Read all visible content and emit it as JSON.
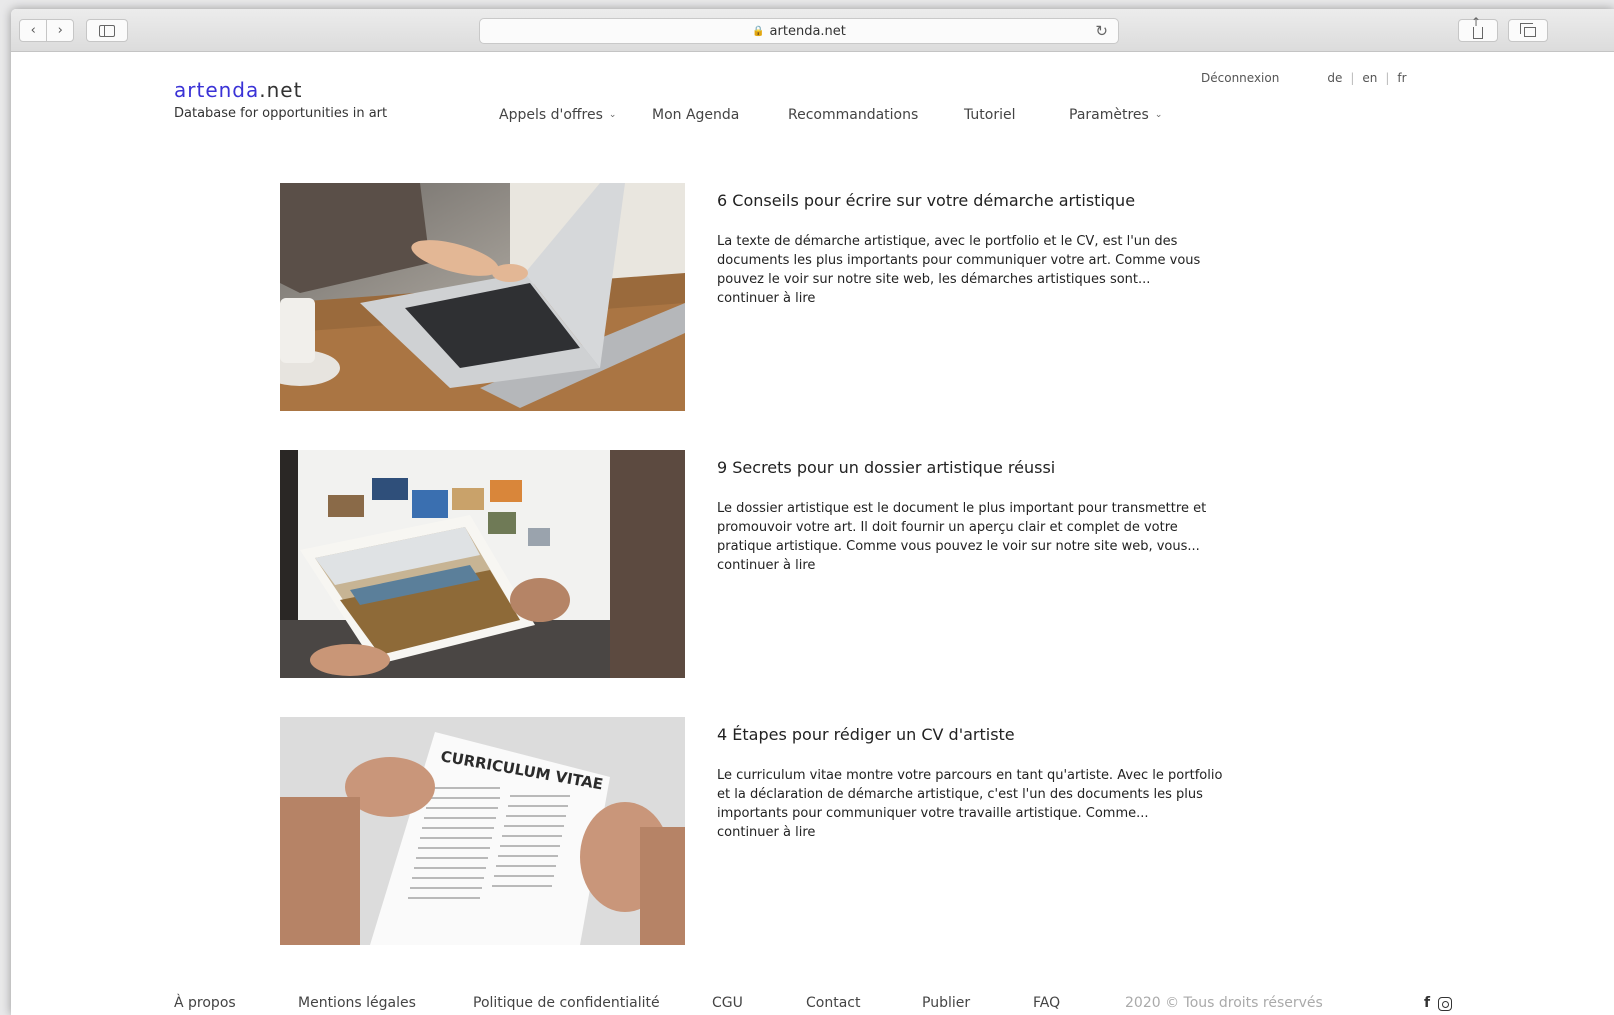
{
  "browser": {
    "url": "artenda.net",
    "back_glyph": "‹",
    "forward_glyph": "›",
    "reload_glyph": "↻",
    "lock_glyph": "🔒"
  },
  "site": {
    "logo_part1": "artenda",
    "logo_part2": ".net",
    "tagline": "Database for opportunities in art",
    "logo_accent_color": "#3a32d6"
  },
  "top_links": {
    "logout": "Déconnexion",
    "languages": [
      "de",
      "en",
      "fr"
    ]
  },
  "nav": {
    "items": [
      {
        "label": "Appels d'offres",
        "dropdown": true
      },
      {
        "label": "Mon Agenda",
        "dropdown": false
      },
      {
        "label": "Recommandations",
        "dropdown": false
      },
      {
        "label": "Tutoriel",
        "dropdown": false
      },
      {
        "label": "Paramètres",
        "dropdown": true
      }
    ],
    "caret_glyph": "⌄"
  },
  "articles": [
    {
      "title": "6 Conseils pour écrire sur votre démarche artistique",
      "excerpt": "La texte de démarche artistique, avec le portfolio et le CV, est l'un des documents les plus importants pour communiquer votre art. Comme vous pouvez le voir sur notre site web, les démarches artistiques sont...",
      "more": "continuer à lire"
    },
    {
      "title": "9 Secrets pour un dossier artistique réussi",
      "excerpt": "Le dossier artistique est le document le plus important pour transmettre et promouvoir votre art. Il doit fournir un aperçu clair et complet de votre pratique artistique. Comme vous pouvez le voir sur notre site web, vous...",
      "more": "continuer à lire"
    },
    {
      "title": "4 Étapes pour rédiger un CV d'artiste",
      "excerpt": "Le curriculum vitae montre votre parcours en tant qu'artiste. Avec le portfolio et la déclaration de démarche artistique, c'est l'un des documents les plus importants pour communiquer votre travaille artistique. Comme...",
      "more": "continuer à lire",
      "image_text": "CURRICULUM VITAE"
    }
  ],
  "footer": {
    "links": [
      "À propos",
      "Mentions légales",
      "Politique de confidentialité",
      "CGU",
      "Contact",
      "Publier",
      "FAQ"
    ],
    "copyright": "2020 © Tous droits réservés",
    "facebook_glyph": "f"
  }
}
